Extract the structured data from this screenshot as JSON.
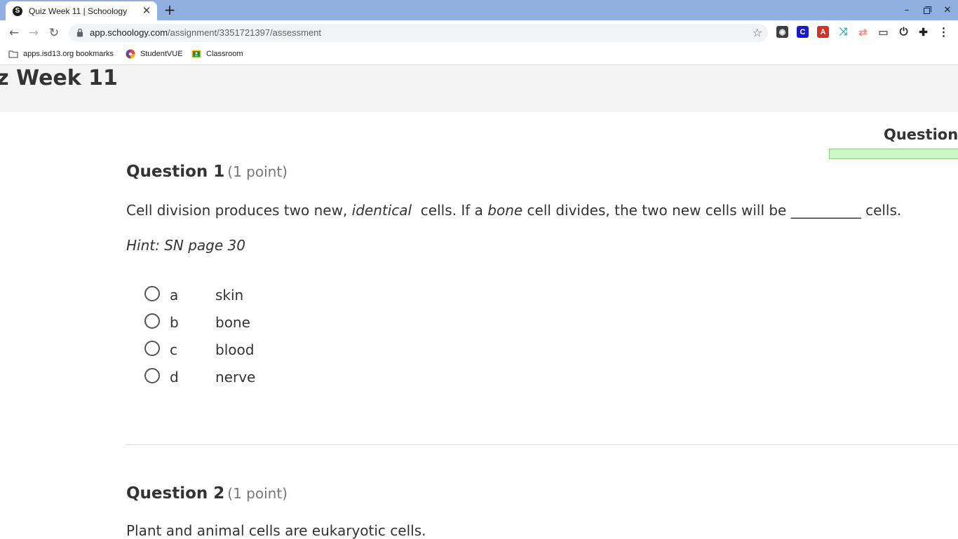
{
  "browser": {
    "tab_title": "Quiz Week 11 | Schoology",
    "tab_favicon_letter": "S",
    "tab_close_icon": "close-icon",
    "new_tab_icon": "plus-icon",
    "window_controls": [
      "minimize-icon",
      "restore-icon",
      "close-icon"
    ],
    "url_host": "app.schoology.com",
    "url_path": "/assignment/3351721397/assessment",
    "bookmarks": [
      {
        "label": "apps.isd13.org bookmarks",
        "icon": "folder-icon"
      },
      {
        "label": "StudentVUE",
        "icon": "studentvue-icon"
      },
      {
        "label": "Classroom",
        "icon": "classroom-icon"
      }
    ],
    "extensions": [
      {
        "icon": "camera-extension-icon",
        "color": "#3c4043",
        "glyph": "◉"
      },
      {
        "icon": "c-extension-icon",
        "color": "#1a1ac8",
        "glyph": "C"
      },
      {
        "icon": "red-extension-icon",
        "color": "#d93025",
        "glyph": "A"
      },
      {
        "icon": "cyan-extension-icon",
        "color": "#24b6d8",
        "glyph": "⤨"
      },
      {
        "icon": "pink-extension-icon",
        "color": "#f28b82",
        "glyph": "⇄"
      },
      {
        "icon": "cast-extension-icon",
        "color": "#5f6368",
        "glyph": "▭"
      },
      {
        "icon": "power-icon",
        "color": "#202124",
        "glyph": "⏻"
      },
      {
        "icon": "puzzle-icon",
        "color": "#202124",
        "glyph": "✚"
      },
      {
        "icon": "menu-icon",
        "color": "#202124",
        "glyph": "⋮"
      }
    ]
  },
  "page": {
    "title": "ek 11",
    "questions_label": "Questions"
  },
  "questions": [
    {
      "number": "Question 1",
      "points": "(1 point)",
      "text_parts": {
        "p1": "Cell division produces two new, ",
        "p2": "identical",
        "p3": "  cells. If a ",
        "p4": "bone",
        "p5": " cell divides, the two new cells will be __________ cells."
      },
      "hint": "Hint: SN page 30",
      "choices": [
        {
          "letter": "a",
          "text": "skin"
        },
        {
          "letter": "b",
          "text": "bone"
        },
        {
          "letter": "c",
          "text": "blood"
        },
        {
          "letter": "d",
          "text": "nerve"
        }
      ]
    },
    {
      "number": "Question 2",
      "points": "(1 point)",
      "text": "Plant and animal cells are eukaryotic cells."
    }
  ],
  "colors": {
    "tabstrip": "#8fb0e0",
    "header_bg": "#f4f4f4",
    "progress_fill": "#cdf7c5",
    "progress_border": "#8ad07a",
    "points_gray": "#777777"
  }
}
